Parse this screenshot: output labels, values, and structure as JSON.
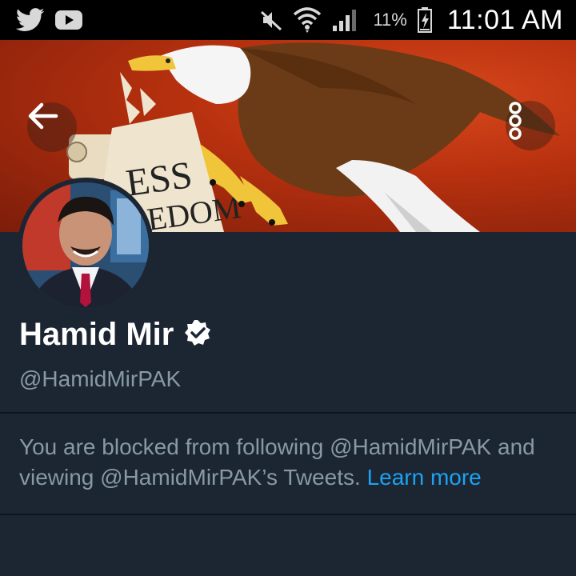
{
  "status_bar": {
    "left_icons": [
      "twitter-icon",
      "youtube-icon"
    ],
    "right_icons": [
      "mute-icon",
      "wifi-icon",
      "signal-icon",
      "battery-icon"
    ],
    "battery_percent": "11%",
    "time": "11:01 AM"
  },
  "header": {
    "back_icon": "arrow-left-icon",
    "more_icon": "more-vertical-icon",
    "banner_text": [
      "ESS",
      "EDOM"
    ]
  },
  "profile": {
    "display_name": "Hamid Mir",
    "verified_icon": "verified-badge-icon",
    "handle": "@HamidMirPAK"
  },
  "notice": {
    "text": "You are blocked from following @HamidMirPAK and viewing @HamidMirPAK’s Tweets.",
    "link": "Learn more"
  },
  "colors": {
    "background": "#1c2633",
    "link": "#1da1f2",
    "secondary_text": "#8899a6",
    "primary_text": "#ffffff"
  }
}
